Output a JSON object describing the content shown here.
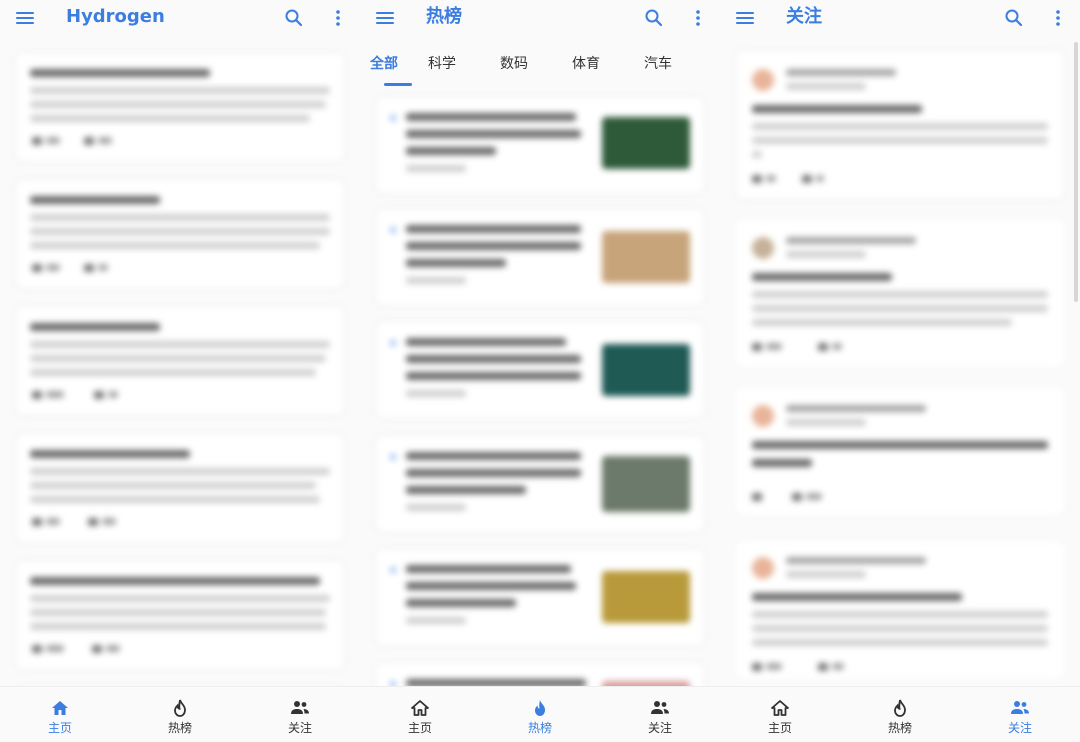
{
  "colors": {
    "accent": "#3b7de0",
    "text": "#333333",
    "background": "#fafafa"
  },
  "screens": [
    {
      "title": "Hydrogen",
      "search_icon": "search-icon",
      "more_icon": "more-vert-icon"
    },
    {
      "title": "热榜",
      "search_icon": "search-icon",
      "more_icon": "more-vert-icon",
      "tabs": [
        "全部",
        "科学",
        "数码",
        "体育",
        "汽车"
      ],
      "active_tab": "全部"
    },
    {
      "title": "关注",
      "search_icon": "search-icon",
      "more_icon": "more-vert-icon"
    }
  ],
  "bottom_nav": [
    {
      "label": "主页",
      "icon": "home-icon"
    },
    {
      "label": "热榜",
      "icon": "fire-icon"
    },
    {
      "label": "关注",
      "icon": "people-icon"
    }
  ],
  "active_nav": [
    "主页",
    "热榜",
    "关注"
  ]
}
